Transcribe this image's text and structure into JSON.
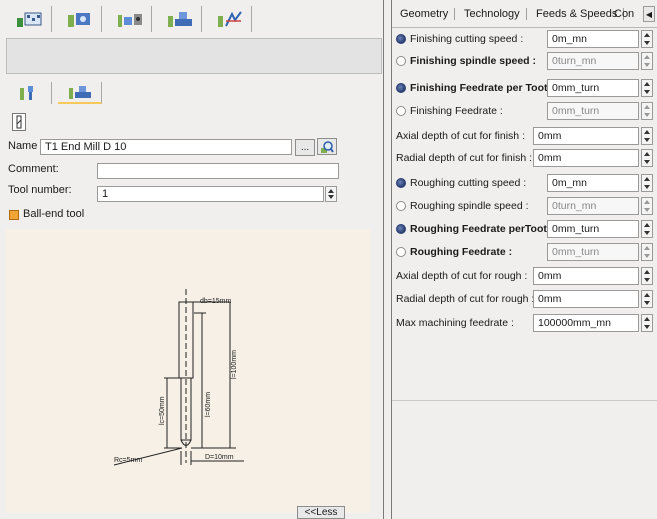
{
  "left_panel": {
    "toolbar_icons": [
      "part-operation-icon",
      "tool-holder-icon",
      "tool-assembly-icon",
      "machine-icon",
      "feeds-icon"
    ],
    "sub_tab_icons": [
      "tool-geometry-icon",
      "tool-assembly-icon"
    ],
    "name_label": "Name",
    "name_value": "T1 End Mill D 10",
    "browse_button": "...",
    "comment_label": "Comment:",
    "comment_value": "",
    "tool_number_label": "Tool number:",
    "tool_number_value": "1",
    "ball_end_label": "Ball-end tool",
    "less_button": "<<Less",
    "sketch_labels": {
      "db": "db=15mm",
      "l_total": "l=100mm",
      "lc": "lc=50mm",
      "l_eff": "l=60mm",
      "rc": "Rc=5mm",
      "d": "D=10mm"
    }
  },
  "right_panel": {
    "tabs": [
      "Geometry",
      "Technology",
      "Feeds & Speeds",
      "Con"
    ],
    "active_tab": "Feeds & Speeds",
    "params": [
      {
        "type": "radio",
        "on": true,
        "label": "Finishing cutting speed :",
        "bold": false,
        "value": "0m_mn",
        "disabled": false
      },
      {
        "type": "radio",
        "on": false,
        "label": "Finishing spindle speed :",
        "bold": true,
        "value": "0turn_mn",
        "disabled": true
      },
      {
        "type": "radio",
        "on": true,
        "label": "Finishing Feedrate per Tooth:",
        "bold": true,
        "value": "0mm_turn",
        "disabled": false
      },
      {
        "type": "radio",
        "on": false,
        "label": "Finishing Feedrate :",
        "bold": false,
        "value": "0mm_turn",
        "disabled": true
      },
      {
        "type": "plain",
        "label": "Axial depth of cut for finish :",
        "value": "0mm"
      },
      {
        "type": "plain",
        "label": "Radial depth of cut for finish :",
        "value": "0mm"
      },
      {
        "type": "radio",
        "on": true,
        "label": "Roughing cutting speed :",
        "bold": false,
        "value": "0m_mn",
        "disabled": false
      },
      {
        "type": "radio",
        "on": false,
        "label": "Roughing spindle speed :",
        "bold": false,
        "value": "0turn_mn",
        "disabled": true
      },
      {
        "type": "radio",
        "on": true,
        "label": "Roughing Feedrate perTooth:",
        "bold": true,
        "value": "0mm_turn",
        "disabled": false
      },
      {
        "type": "radio",
        "on": false,
        "label": "Roughing Feedrate :",
        "bold": true,
        "value": "0mm_turn",
        "disabled": true
      },
      {
        "type": "plain",
        "label": "Axial depth of cut for rough :",
        "value": "0mm"
      },
      {
        "type": "plain",
        "label": "Radial depth of cut for rough :",
        "value": "0mm"
      },
      {
        "type": "plain",
        "label": "Max machining feedrate :",
        "value": "100000mm_mn"
      }
    ]
  },
  "colors": {
    "background": "#f0efed",
    "radio_on": "#2b3f73",
    "checkbox": "#f1a534",
    "sketch_bg": "#f6f0e6"
  }
}
